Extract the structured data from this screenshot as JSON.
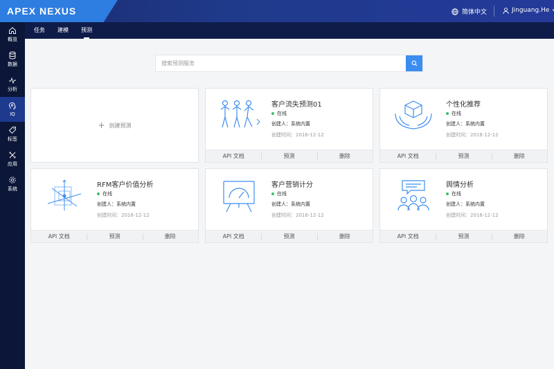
{
  "app": {
    "logo": "APEX NEXUS",
    "language": "简体中文",
    "user": "Jinguang.He"
  },
  "subnav": {
    "tabs": [
      "任务",
      "建模",
      "预测"
    ],
    "active": "预测"
  },
  "sidebar": {
    "items": [
      {
        "label": "概览",
        "icon": "home-icon"
      },
      {
        "label": "数据",
        "icon": "database-icon"
      },
      {
        "label": "分析",
        "icon": "pulse-icon"
      },
      {
        "label": "IQ",
        "icon": "brain-icon",
        "active": true
      },
      {
        "label": "标签",
        "icon": "tag-icon"
      },
      {
        "label": "应用",
        "icon": "tools-icon"
      },
      {
        "label": "系统",
        "icon": "settings-icon"
      }
    ]
  },
  "search": {
    "placeholder": "搜索预测服务"
  },
  "create": {
    "label": "创建预测"
  },
  "footer_labels": {
    "api": "API 文档",
    "predict": "预测",
    "delete": "删除"
  },
  "cards": [
    {
      "title": "客户流失预测01",
      "status": "在线",
      "creator": "创建人：系统内置",
      "time": "创建时间：2016-12-12",
      "icon": "people-walking-icon"
    },
    {
      "title": "个性化推荐",
      "status": "在线",
      "creator": "创建人：系统内置",
      "time": "创建时间：2016-12-12",
      "icon": "box-in-hands-icon"
    },
    {
      "title": "RFM客户价值分析",
      "status": "在线",
      "creator": "创建人：系统内置",
      "time": "创建时间：2016-12-12",
      "icon": "3d-axis-icon"
    },
    {
      "title": "客户营销计分",
      "status": "在线",
      "creator": "创建人：系统内置",
      "time": "创建时间：2016-12-12",
      "icon": "gauge-board-icon"
    },
    {
      "title": "舆情分析",
      "status": "在线",
      "creator": "创建人：系统内置",
      "time": "创建时间：2016-12-12",
      "icon": "group-chat-icon"
    }
  ],
  "colors": {
    "accent": "#3b8df0",
    "online": "#3bbf6a",
    "sidebar": "#0b1638"
  }
}
